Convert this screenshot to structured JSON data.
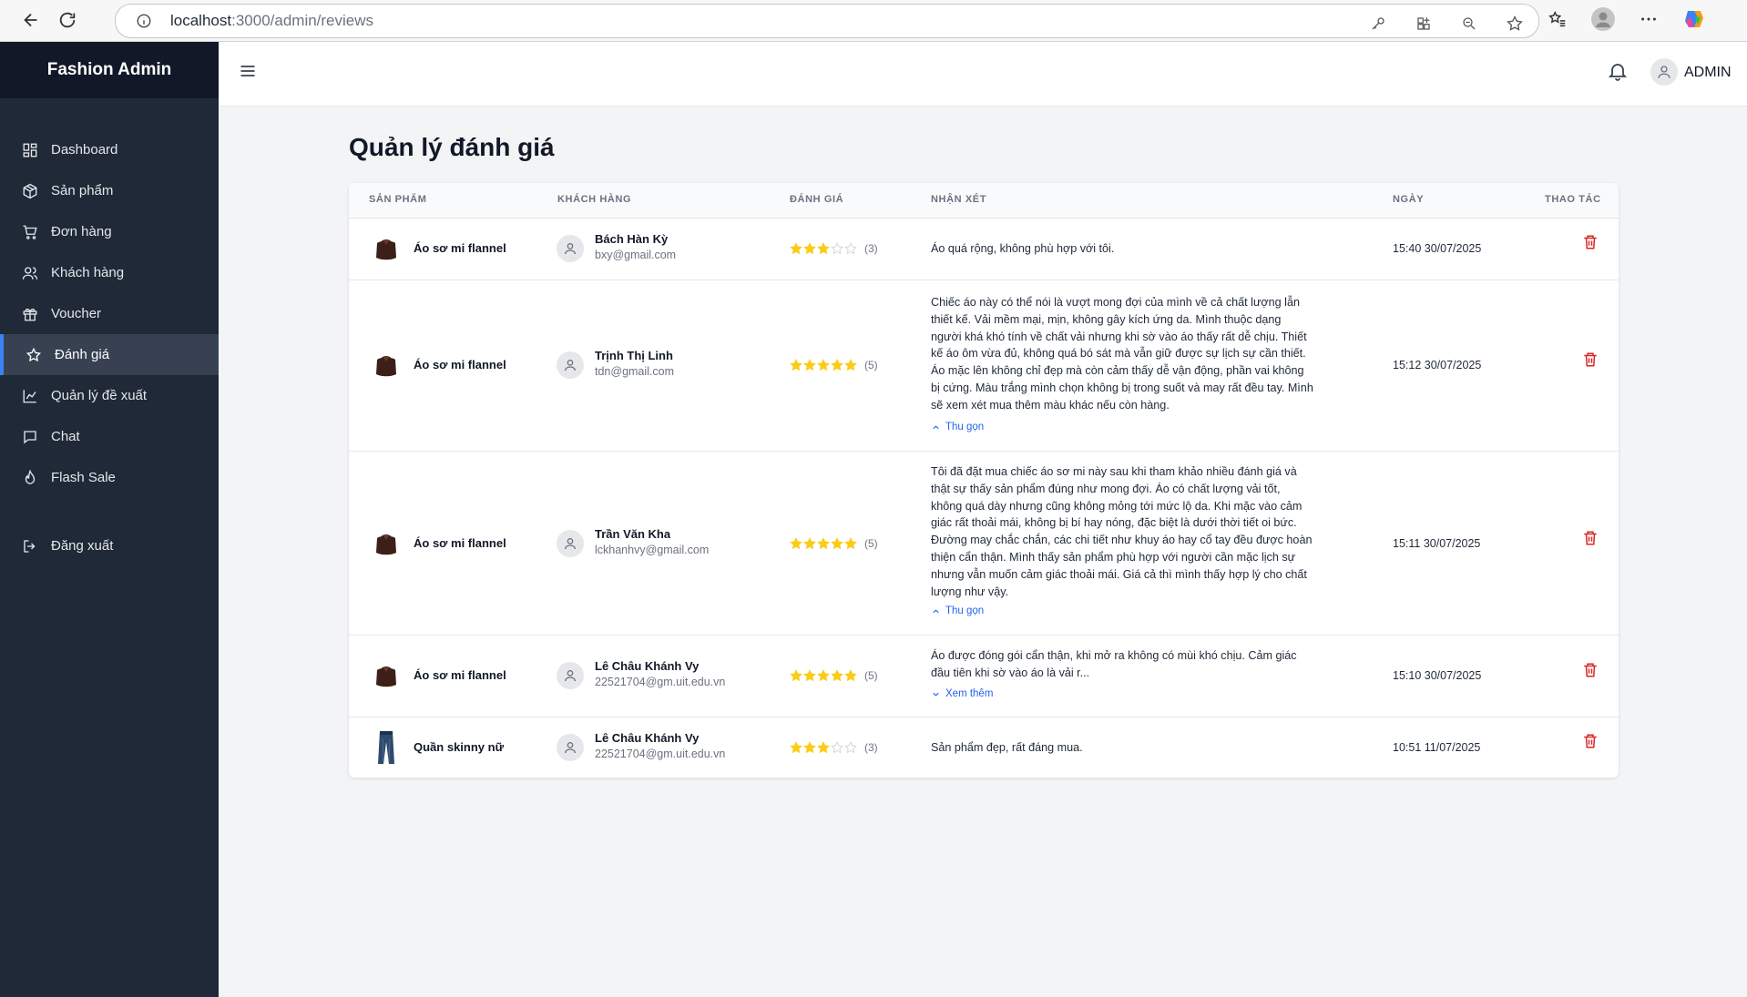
{
  "browser": {
    "url_host": "localhost",
    "url_path": ":3000/admin/reviews"
  },
  "sidebar": {
    "brand": "Fashion Admin",
    "items": [
      {
        "label": "Dashboard",
        "icon": "grid-icon"
      },
      {
        "label": "Sản phẩm",
        "icon": "box-icon"
      },
      {
        "label": "Đơn hàng",
        "icon": "cart-icon"
      },
      {
        "label": "Khách hàng",
        "icon": "users-icon"
      },
      {
        "label": "Voucher",
        "icon": "gift-icon"
      },
      {
        "label": "Đánh giá",
        "icon": "star-icon",
        "active": true
      },
      {
        "label": "Quản lý đề xuất",
        "icon": "chart-icon"
      },
      {
        "label": "Chat",
        "icon": "chat-icon"
      },
      {
        "label": "Flash Sale",
        "icon": "flame-icon"
      }
    ],
    "logout": "Đăng xuất"
  },
  "topbar": {
    "user": "ADMIN"
  },
  "page": {
    "title": "Quản lý đánh giá"
  },
  "table": {
    "headers": {
      "product": "SẢN PHẨM",
      "customer": "KHÁCH HÀNG",
      "rating": "ĐÁNH GIÁ",
      "comment": "NHẬN XÉT",
      "date": "NGÀY",
      "actions": "THAO TÁC"
    },
    "rows": [
      {
        "product": "Áo sơ mi flannel",
        "product_image": "shirt",
        "customer_name": "Bách Hàn Kỳ",
        "customer_email": "bxy@gmail.com",
        "rating": 3,
        "rating_label": "(3)",
        "comment": "Áo quá rộng, không phù hợp với tôi.",
        "toggle": "",
        "date": "15:40 30/07/2025"
      },
      {
        "product": "Áo sơ mi flannel",
        "product_image": "shirt",
        "customer_name": "Trịnh Thị Linh",
        "customer_email": "tdn@gmail.com",
        "rating": 5,
        "rating_label": "(5)",
        "comment": "Chiếc áo này có thể nói là vượt mong đợi của mình về cả chất lượng lẫn thiết kế. Vải mềm mại, mịn, không gây kích ứng da. Mình thuộc dạng người khá khó tính về chất vải nhưng khi sờ vào áo thấy rất dễ chịu. Thiết kế áo ôm vừa đủ, không quá bó sát mà vẫn giữ được sự lịch sự cần thiết. Áo mặc lên không chỉ đẹp mà còn cảm thấy dễ vận động, phần vai không bị cứng. Màu trắng mình chọn không bị trong suốt và may rất đều tay. Mình sẽ xem xét mua thêm màu khác nếu còn hàng.",
        "toggle": "Thu gọn",
        "toggle_dir": "up",
        "date": "15:12 30/07/2025"
      },
      {
        "product": "Áo sơ mi flannel",
        "product_image": "shirt",
        "customer_name": "Trần Văn Kha",
        "customer_email": "lckhanhvy@gmail.com",
        "rating": 5,
        "rating_label": "(5)",
        "comment": "Tôi đã đặt mua chiếc áo sơ mi này sau khi tham khảo nhiều đánh giá và thật sự thấy sản phẩm đúng như mong đợi. Áo có chất lượng vải tốt, không quá dày nhưng cũng không mỏng tới mức lộ da. Khi mặc vào cảm giác rất thoải mái, không bị bí hay nóng, đặc biệt là dưới thời tiết oi bức. Đường may chắc chắn, các chi tiết như khuy áo hay cổ tay đều được hoàn thiện cẩn thận. Mình thấy sản phẩm phù hợp với người cần mặc lịch sự nhưng vẫn muốn cảm giác thoải mái. Giá cả thì mình thấy hợp lý cho chất lượng như vậy.",
        "toggle": "Thu gọn",
        "toggle_dir": "up",
        "date": "15:11 30/07/2025"
      },
      {
        "product": "Áo sơ mi flannel",
        "product_image": "shirt",
        "customer_name": "Lê Châu Khánh Vy",
        "customer_email": "22521704@gm.uit.edu.vn",
        "rating": 5,
        "rating_label": "(5)",
        "comment": "Áo được đóng gói cẩn thận, khi mở ra không có mùi khó chịu. Cảm giác đầu tiên khi sờ vào áo là vải r...",
        "toggle": "Xem thêm",
        "toggle_dir": "down",
        "date": "15:10 30/07/2025"
      },
      {
        "product": "Quần skinny nữ",
        "product_image": "jeans",
        "customer_name": "Lê Châu Khánh Vy",
        "customer_email": "22521704@gm.uit.edu.vn",
        "rating": 3,
        "rating_label": "(3)",
        "comment": "Sản phẩm đẹp, rất đáng mua.",
        "toggle": "",
        "date": "10:51 11/07/2025"
      }
    ]
  },
  "colors": {
    "sidebar_bg": "#1f2937",
    "brand_bg": "#111827",
    "active_accent": "#3b82f6",
    "star": "#facc15",
    "delete": "#dc2626",
    "link": "#2563eb"
  }
}
